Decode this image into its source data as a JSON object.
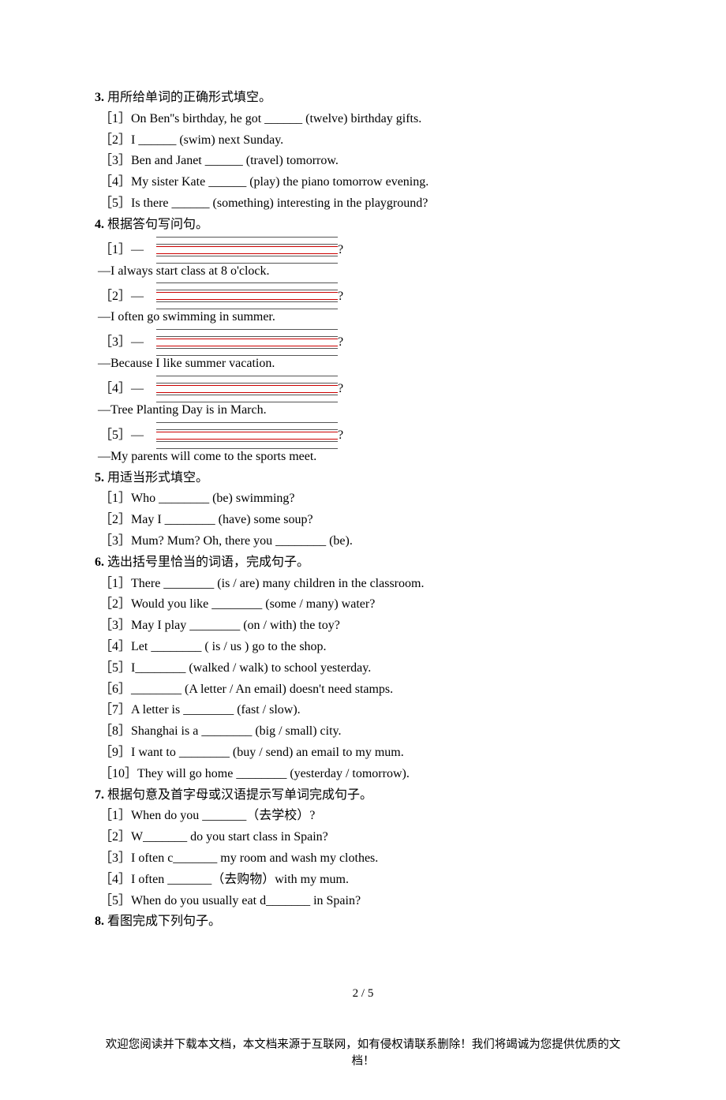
{
  "q3": {
    "title": "3.",
    "instructions": "用所给单词的正确形式填空。",
    "items": [
      "［1］On Ben''s birthday, he got ______ (twelve) birthday gifts.",
      "［2］I ______ (swim) next Sunday.",
      "［3］Ben and Janet ______ (travel) tomorrow.",
      "［4］My sister Kate ______ (play) the piano tomorrow evening.",
      "［5］Is there ______ (something) interesting in the playground?"
    ]
  },
  "q4": {
    "title": "4.",
    "instructions": "根据答句写问句。",
    "pairs": [
      {
        "num": "［1］—",
        "answer": "—I always start class at 8 o'clock."
      },
      {
        "num": "［2］—",
        "answer": "—I often go swimming in summer."
      },
      {
        "num": "［3］—",
        "answer": "—Because I like summer vacation."
      },
      {
        "num": "［4］—",
        "answer": "—Tree Planting Day is in March."
      },
      {
        "num": "［5］—",
        "answer": "—My parents will come to the sports meet."
      }
    ],
    "qmark": "?"
  },
  "q5": {
    "title": "5.",
    "instructions": "用适当形式填空。",
    "items": [
      "［1］Who ________ (be) swimming?",
      "［2］May I ________ (have) some soup?",
      "［3］Mum? Mum? Oh, there you ________ (be)."
    ]
  },
  "q6": {
    "title": "6.",
    "instructions": "选出括号里恰当的词语，完成句子。",
    "items": [
      "［1］There ________ (is / are) many children in the classroom.",
      "［2］Would you like ________ (some / many) water?",
      "［3］May I play ________ (on / with) the toy?",
      "［4］Let ________ ( is / us ) go to the shop.",
      "［5］I________ (walked / walk) to school yesterday.",
      "［6］________ (A letter / An email) doesn't need stamps.",
      "［7］A letter is ________ (fast / slow).",
      "［8］Shanghai is a ________ (big / small) city.",
      "［9］I want to ________ (buy / send) an email to my mum.",
      "［10］They will go home ________ (yesterday / tomorrow)."
    ]
  },
  "q7": {
    "title": "7.",
    "instructions": "根据句意及首字母或汉语提示写单词完成句子。",
    "items": [
      "［1］When do you _______（去学校）?",
      "［2］W_______ do you start class in Spain?",
      "［3］I often c_______ my room and wash my clothes.",
      "［4］I often _______（去购物）with my mum.",
      "［5］When do you usually eat d_______ in Spain?"
    ]
  },
  "q8": {
    "title": "8.",
    "instructions": "看图完成下列句子。"
  },
  "footer": {
    "page": "2 / 5",
    "note": "欢迎您阅读并下载本文档，本文档来源于互联网，如有侵权请联系删除！我们将竭诚为您提供优质的文档！"
  }
}
